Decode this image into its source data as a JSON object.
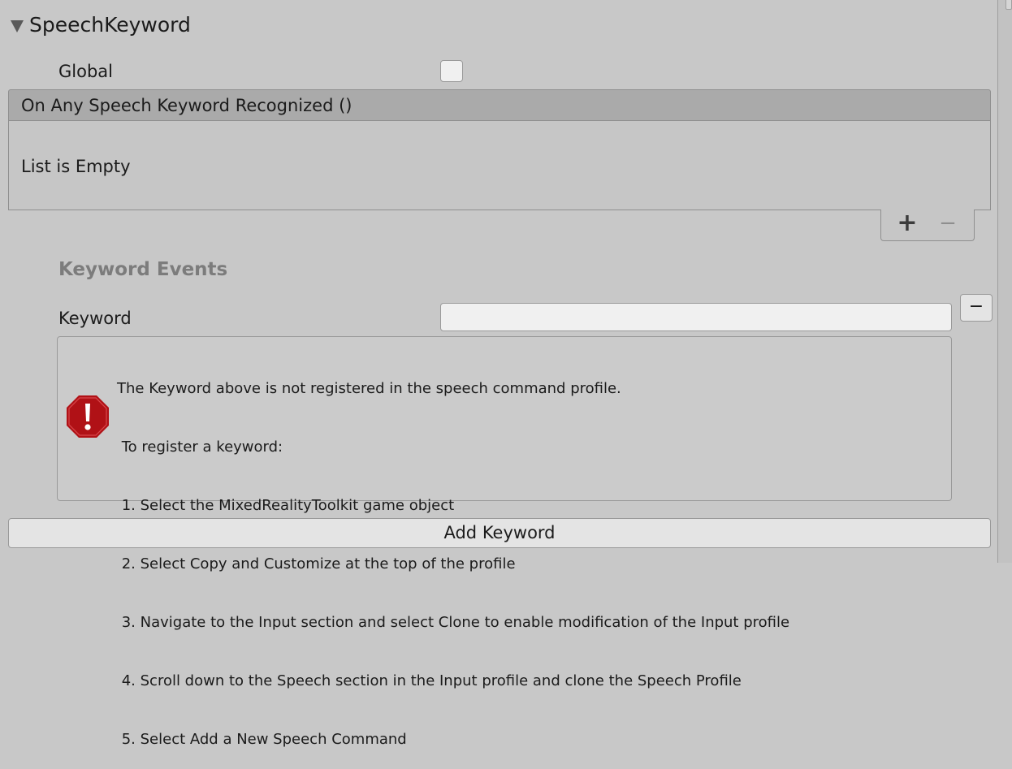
{
  "component": {
    "title": "SpeechKeyword",
    "expanded": true
  },
  "global": {
    "label": "Global",
    "checked": false
  },
  "event": {
    "header": "On Any Speech Keyword Recognized ()",
    "empty_text": "List is Empty",
    "add_label": "+",
    "remove_label": "−"
  },
  "keyword_events": {
    "heading": "Keyword Events",
    "keyword_label": "Keyword",
    "keyword_value": "",
    "remove_label": "−"
  },
  "help_box": {
    "icon": "error-icon",
    "lines": [
      "The Keyword above is not registered in the speech command profile.",
      " To register a keyword:",
      " 1. Select the MixedRealityToolkit game object",
      " 2. Select Copy and Customize at the top of the profile",
      " 3. Navigate to the Input section and select Clone to enable modification of the Input profile",
      " 4. Scroll down to the Speech section in the Input profile and clone the Speech Profile",
      " 5. Select Add a New Speech Command"
    ]
  },
  "add_keyword": {
    "label": "Add Keyword"
  },
  "colors": {
    "background": "#c8c8c8",
    "event_header": "#aaaaaa",
    "error_red": "#b01116",
    "heading_gray": "#7c7c7c"
  }
}
